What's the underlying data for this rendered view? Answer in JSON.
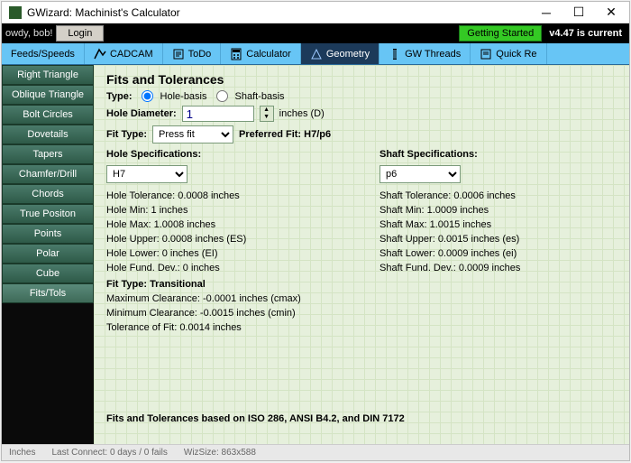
{
  "window": {
    "title": "GWizard: Machinist's Calculator"
  },
  "topbar": {
    "greeting": "owdy, bob!",
    "login": "Login",
    "getting_started": "Getting Started",
    "version": "v4.47 is current"
  },
  "tabs": {
    "feeds": "Feeds/Speeds",
    "cadcam": "CADCAM",
    "todo": "ToDo",
    "calculator": "Calculator",
    "geometry": "Geometry",
    "gwthreads": "GW Threads",
    "quickref": "Quick Re"
  },
  "sidebar": {
    "items": [
      "Right Triangle",
      "Oblique Triangle",
      "Bolt Circles",
      "Dovetails",
      "Tapers",
      "Chamfer/Drill",
      "Chords",
      "True Positon",
      "Points",
      "Polar",
      "Cube",
      "Fits/Tols"
    ]
  },
  "main": {
    "heading": "Fits and Tolerances",
    "type_label": "Type:",
    "type_hole": "Hole-basis",
    "type_shaft": "Shaft-basis",
    "dia_label": "Hole Diameter:",
    "dia_value": "1",
    "dia_units": "inches (D)",
    "fit_type_label": "Fit Type:",
    "fit_type_value": "Press fit",
    "preferred_label": "Preferred Fit: H7/p6",
    "hole": {
      "header": "Hole Specifications:",
      "select": "H7",
      "l1": "Hole Tolerance: 0.0008 inches",
      "l2": "Hole Min: 1 inches",
      "l3": "Hole Max: 1.0008 inches",
      "l4": "Hole Upper: 0.0008 inches (ES)",
      "l5": "Hole Lower: 0 inches (EI)",
      "l6": "Hole Fund. Dev.: 0 inches"
    },
    "shaft": {
      "header": "Shaft Specifications:",
      "select": "p6",
      "l1": "Shaft Tolerance: 0.0006 inches",
      "l2": "Shaft Min: 1.0009 inches",
      "l3": "Shaft Max: 1.0015 inches",
      "l4": "Shaft Upper: 0.0015 inches (es)",
      "l5": "Shaft Lower: 0.0009 inches (ei)",
      "l6": "Shaft Fund. Dev.: 0.0009 inches"
    },
    "result": {
      "header": "Fit Type: Transitional",
      "l1": "Maximum Clearance: -0.0001 inches (cmax)",
      "l2": "Minimum Clearance: -0.0015 inches (cmin)",
      "l3": "Tolerance of Fit: 0.0014 inches"
    },
    "iso": "Fits and Tolerances based on ISO 286, ANSI B4.2, and DIN 7172"
  },
  "status": {
    "units": "Inches",
    "connect": "Last Connect: 0 days / 0 fails",
    "wiz": "WizSize: 863x588"
  }
}
